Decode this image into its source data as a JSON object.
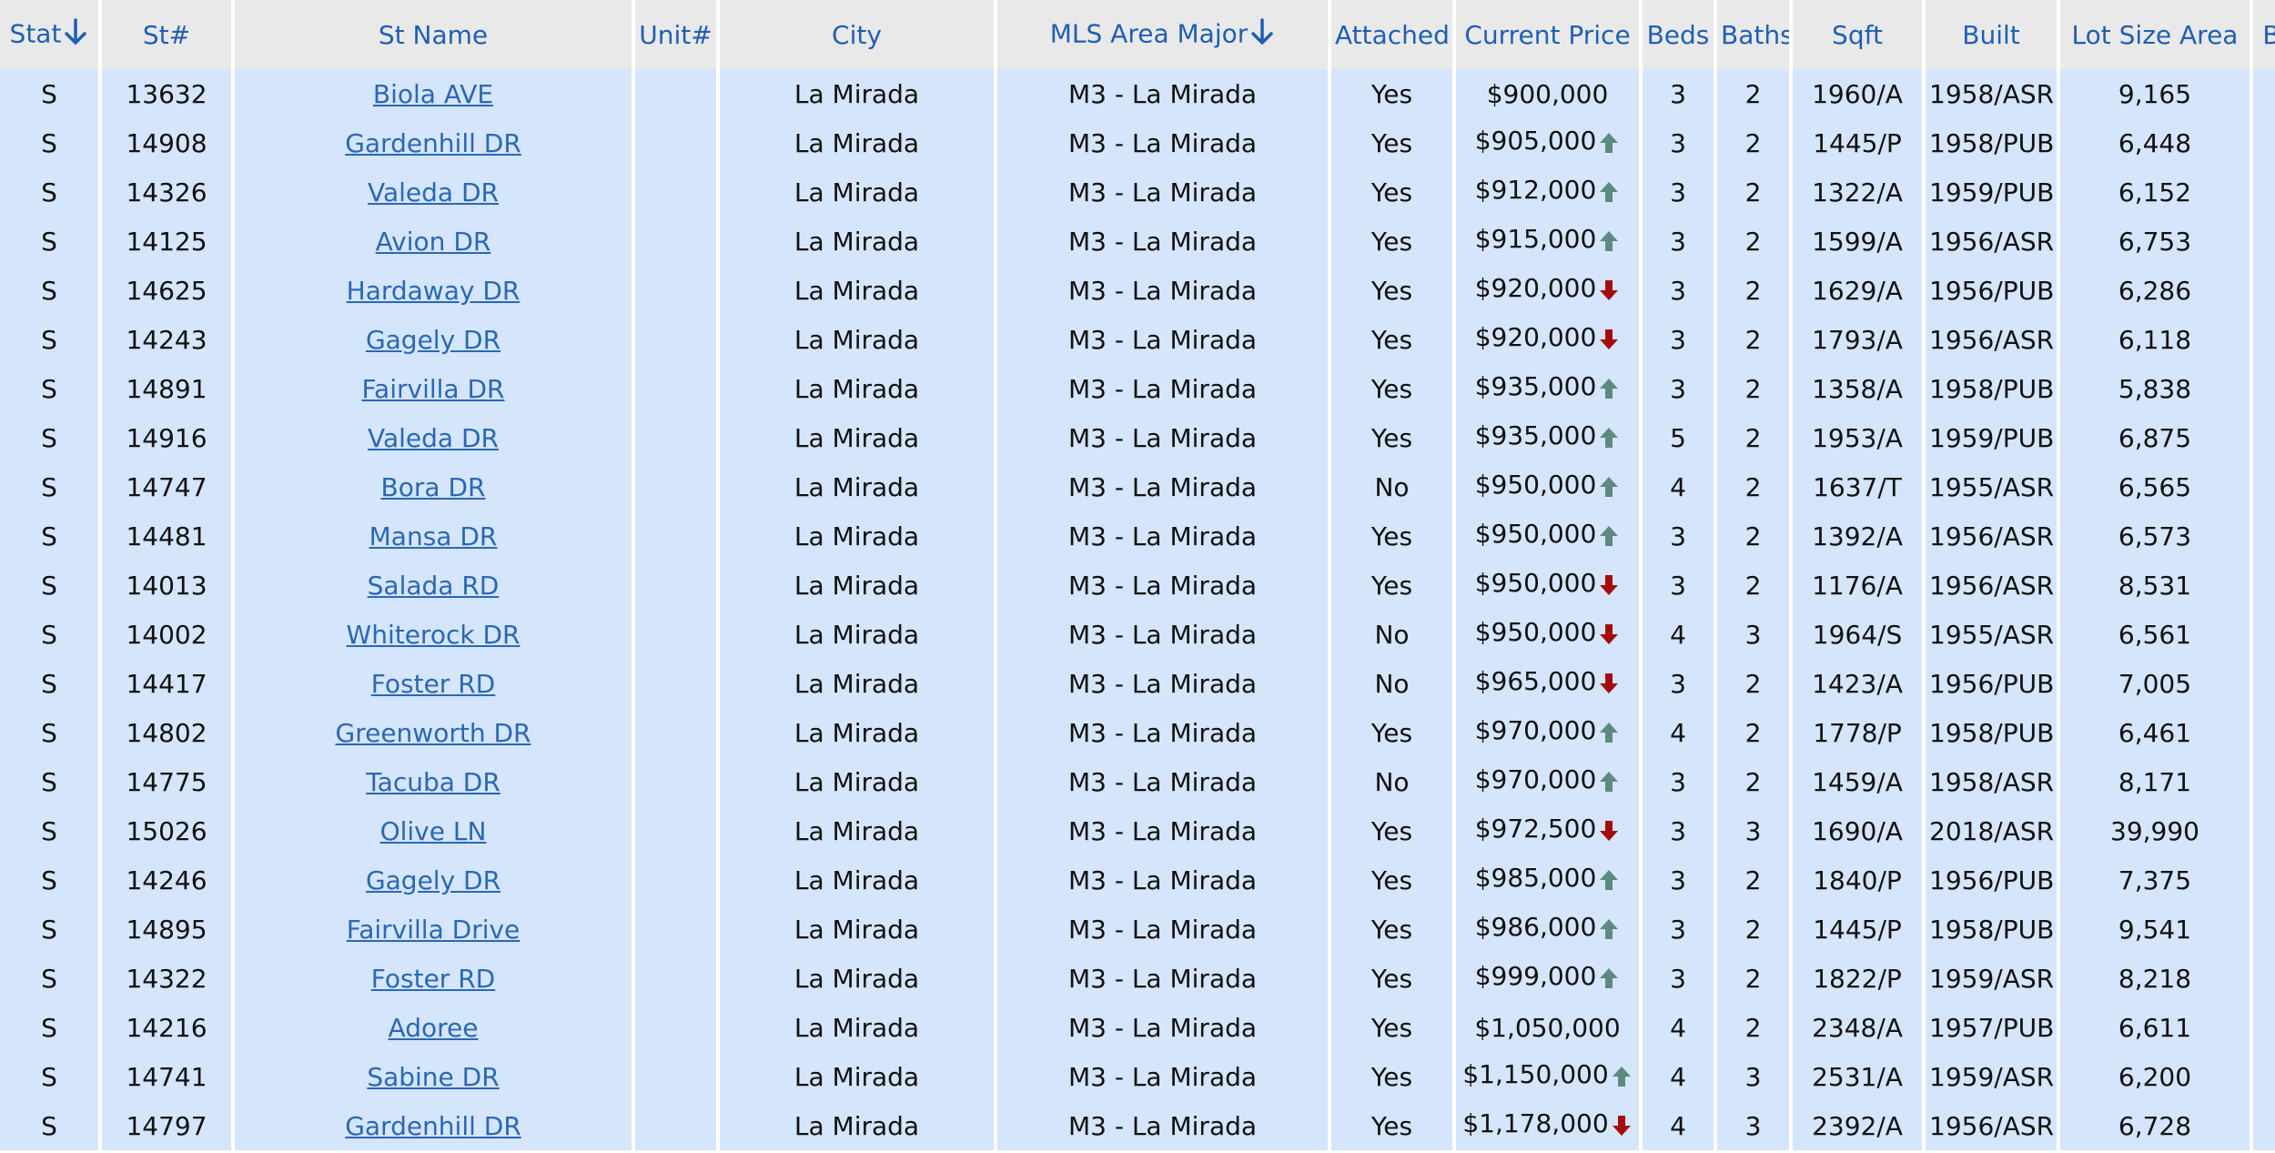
{
  "colors": {
    "header_bg": "#e9e9e9",
    "header_text": "#1f5fb3",
    "row_bg": "#d5e5fb",
    "link": "#2a68b5",
    "arrow_up": "#5d8a7f",
    "arrow_down": "#a40b0b"
  },
  "columns": {
    "stat": "Stat",
    "st_num": "St#",
    "st_name": "St Name",
    "unit": "Unit#",
    "city": "City",
    "mls_area": "MLS Area Major",
    "attached": "Attached",
    "price": "Current Price",
    "beds": "Beds",
    "baths": "Baths",
    "sqft": "Sqft",
    "built": "Built",
    "lot": "Lot Size Area",
    "next": "B"
  },
  "rows": [
    {
      "stat": "S",
      "num": "13632",
      "name": "Biola AVE",
      "unit": "",
      "city": "La Mirada",
      "area": "M3 - La Mirada",
      "attached": "Yes",
      "price": "$900,000",
      "trend": "",
      "beds": "3",
      "baths": "2",
      "sqft": "1960/A",
      "built": "1958/ASR",
      "lot": "9,165"
    },
    {
      "stat": "S",
      "num": "14908",
      "name": "Gardenhill DR",
      "unit": "",
      "city": "La Mirada",
      "area": "M3 - La Mirada",
      "attached": "Yes",
      "price": "$905,000",
      "trend": "up",
      "beds": "3",
      "baths": "2",
      "sqft": "1445/P",
      "built": "1958/PUB",
      "lot": "6,448"
    },
    {
      "stat": "S",
      "num": "14326",
      "name": "Valeda DR",
      "unit": "",
      "city": "La Mirada",
      "area": "M3 - La Mirada",
      "attached": "Yes",
      "price": "$912,000",
      "trend": "up",
      "beds": "3",
      "baths": "2",
      "sqft": "1322/A",
      "built": "1959/PUB",
      "lot": "6,152"
    },
    {
      "stat": "S",
      "num": "14125",
      "name": "Avion DR",
      "unit": "",
      "city": "La Mirada",
      "area": "M3 - La Mirada",
      "attached": "Yes",
      "price": "$915,000",
      "trend": "up",
      "beds": "3",
      "baths": "2",
      "sqft": "1599/A",
      "built": "1956/ASR",
      "lot": "6,753"
    },
    {
      "stat": "S",
      "num": "14625",
      "name": "Hardaway DR",
      "unit": "",
      "city": "La Mirada",
      "area": "M3 - La Mirada",
      "attached": "Yes",
      "price": "$920,000",
      "trend": "down",
      "beds": "3",
      "baths": "2",
      "sqft": "1629/A",
      "built": "1956/PUB",
      "lot": "6,286"
    },
    {
      "stat": "S",
      "num": "14243",
      "name": "Gagely DR",
      "unit": "",
      "city": "La Mirada",
      "area": "M3 - La Mirada",
      "attached": "Yes",
      "price": "$920,000",
      "trend": "down",
      "beds": "3",
      "baths": "2",
      "sqft": "1793/A",
      "built": "1956/ASR",
      "lot": "6,118"
    },
    {
      "stat": "S",
      "num": "14891",
      "name": "Fairvilla DR",
      "unit": "",
      "city": "La Mirada",
      "area": "M3 - La Mirada",
      "attached": "Yes",
      "price": "$935,000",
      "trend": "up",
      "beds": "3",
      "baths": "2",
      "sqft": "1358/A",
      "built": "1958/PUB",
      "lot": "5,838"
    },
    {
      "stat": "S",
      "num": "14916",
      "name": "Valeda DR",
      "unit": "",
      "city": "La Mirada",
      "area": "M3 - La Mirada",
      "attached": "Yes",
      "price": "$935,000",
      "trend": "up",
      "beds": "5",
      "baths": "2",
      "sqft": "1953/A",
      "built": "1959/PUB",
      "lot": "6,875"
    },
    {
      "stat": "S",
      "num": "14747",
      "name": "Bora DR",
      "unit": "",
      "city": "La Mirada",
      "area": "M3 - La Mirada",
      "attached": "No",
      "price": "$950,000",
      "trend": "up",
      "beds": "4",
      "baths": "2",
      "sqft": "1637/T",
      "built": "1955/ASR",
      "lot": "6,565"
    },
    {
      "stat": "S",
      "num": "14481",
      "name": "Mansa DR",
      "unit": "",
      "city": "La Mirada",
      "area": "M3 - La Mirada",
      "attached": "Yes",
      "price": "$950,000",
      "trend": "up",
      "beds": "3",
      "baths": "2",
      "sqft": "1392/A",
      "built": "1956/ASR",
      "lot": "6,573"
    },
    {
      "stat": "S",
      "num": "14013",
      "name": "Salada RD",
      "unit": "",
      "city": "La Mirada",
      "area": "M3 - La Mirada",
      "attached": "Yes",
      "price": "$950,000",
      "trend": "down",
      "beds": "3",
      "baths": "2",
      "sqft": "1176/A",
      "built": "1956/ASR",
      "lot": "8,531"
    },
    {
      "stat": "S",
      "num": "14002",
      "name": "Whiterock DR",
      "unit": "",
      "city": "La Mirada",
      "area": "M3 - La Mirada",
      "attached": "No",
      "price": "$950,000",
      "trend": "down",
      "beds": "4",
      "baths": "3",
      "sqft": "1964/S",
      "built": "1955/ASR",
      "lot": "6,561"
    },
    {
      "stat": "S",
      "num": "14417",
      "name": "Foster RD",
      "unit": "",
      "city": "La Mirada",
      "area": "M3 - La Mirada",
      "attached": "No",
      "price": "$965,000",
      "trend": "down",
      "beds": "3",
      "baths": "2",
      "sqft": "1423/A",
      "built": "1956/PUB",
      "lot": "7,005"
    },
    {
      "stat": "S",
      "num": "14802",
      "name": "Greenworth DR",
      "unit": "",
      "city": "La Mirada",
      "area": "M3 - La Mirada",
      "attached": "Yes",
      "price": "$970,000",
      "trend": "up",
      "beds": "4",
      "baths": "2",
      "sqft": "1778/P",
      "built": "1958/PUB",
      "lot": "6,461"
    },
    {
      "stat": "S",
      "num": "14775",
      "name": "Tacuba DR",
      "unit": "",
      "city": "La Mirada",
      "area": "M3 - La Mirada",
      "attached": "No",
      "price": "$970,000",
      "trend": "up",
      "beds": "3",
      "baths": "2",
      "sqft": "1459/A",
      "built": "1958/ASR",
      "lot": "8,171"
    },
    {
      "stat": "S",
      "num": "15026",
      "name": "Olive LN",
      "unit": "",
      "city": "La Mirada",
      "area": "M3 - La Mirada",
      "attached": "Yes",
      "price": "$972,500",
      "trend": "down",
      "beds": "3",
      "baths": "3",
      "sqft": "1690/A",
      "built": "2018/ASR",
      "lot": "39,990"
    },
    {
      "stat": "S",
      "num": "14246",
      "name": "Gagely DR",
      "unit": "",
      "city": "La Mirada",
      "area": "M3 - La Mirada",
      "attached": "Yes",
      "price": "$985,000",
      "trend": "up",
      "beds": "3",
      "baths": "2",
      "sqft": "1840/P",
      "built": "1956/PUB",
      "lot": "7,375"
    },
    {
      "stat": "S",
      "num": "14895",
      "name": "Fairvilla Drive",
      "unit": "",
      "city": "La Mirada",
      "area": "M3 - La Mirada",
      "attached": "Yes",
      "price": "$986,000",
      "trend": "up",
      "beds": "3",
      "baths": "2",
      "sqft": "1445/P",
      "built": "1958/PUB",
      "lot": "9,541"
    },
    {
      "stat": "S",
      "num": "14322",
      "name": "Foster RD",
      "unit": "",
      "city": "La Mirada",
      "area": "M3 - La Mirada",
      "attached": "Yes",
      "price": "$999,000",
      "trend": "up",
      "beds": "3",
      "baths": "2",
      "sqft": "1822/P",
      "built": "1959/ASR",
      "lot": "8,218"
    },
    {
      "stat": "S",
      "num": "14216",
      "name": "Adoree",
      "unit": "",
      "city": "La Mirada",
      "area": "M3 - La Mirada",
      "attached": "Yes",
      "price": "$1,050,000",
      "trend": "",
      "beds": "4",
      "baths": "2",
      "sqft": "2348/A",
      "built": "1957/PUB",
      "lot": "6,611"
    },
    {
      "stat": "S",
      "num": "14741",
      "name": "Sabine DR",
      "unit": "",
      "city": "La Mirada",
      "area": "M3 - La Mirada",
      "attached": "Yes",
      "price": "$1,150,000",
      "trend": "up",
      "beds": "4",
      "baths": "3",
      "sqft": "2531/A",
      "built": "1959/ASR",
      "lot": "6,200"
    },
    {
      "stat": "S",
      "num": "14797",
      "name": "Gardenhill DR",
      "unit": "",
      "city": "La Mirada",
      "area": "M3 - La Mirada",
      "attached": "Yes",
      "price": "$1,178,000",
      "trend": "down",
      "beds": "4",
      "baths": "3",
      "sqft": "2392/A",
      "built": "1956/ASR",
      "lot": "6,728"
    }
  ]
}
